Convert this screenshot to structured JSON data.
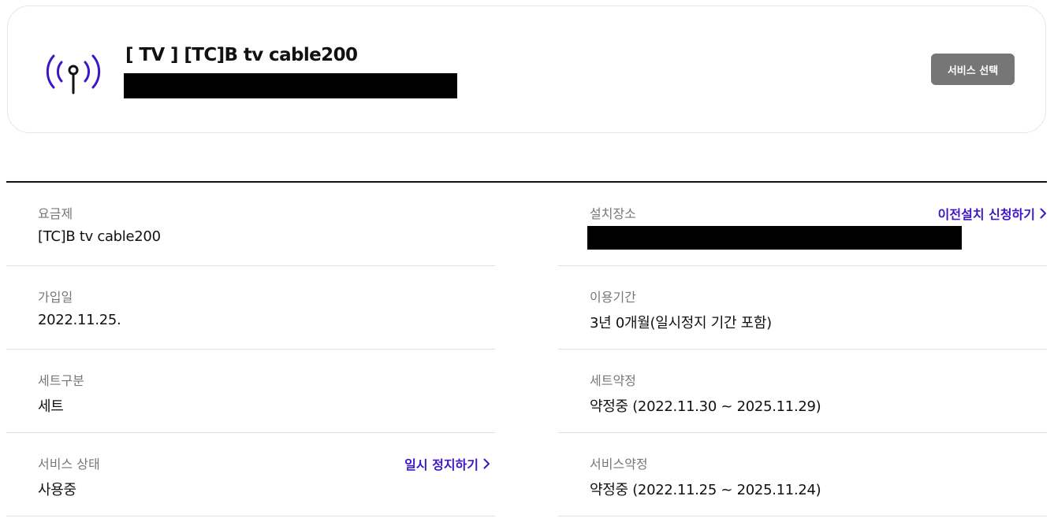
{
  "service_card": {
    "icon": "broadcast-antenna-icon",
    "title": "[ TV ] [TC]B tv cable200",
    "select_button": "서비스 선택"
  },
  "details": {
    "left": [
      {
        "label": "요금제",
        "value": "[TC]B tv cable200"
      },
      {
        "label": "가입일",
        "value": "2022.11.25."
      },
      {
        "label": "세트구분",
        "value": "세트"
      },
      {
        "label": "서비스 상태",
        "value": "사용중",
        "link": "일시 정지하기"
      }
    ],
    "right": [
      {
        "label": "설치장소",
        "link": "이전설치 신청하기"
      },
      {
        "label": "이용기간",
        "value": "3년 0개월(일시정지 기간 포함)"
      },
      {
        "label": "세트약정",
        "value": "약정중 (2022.11.30 ~ 2025.11.29)"
      },
      {
        "label": "서비스약정",
        "value": "약정중 (2022.11.25 ~ 2025.11.24)"
      }
    ]
  },
  "colors": {
    "link": "#3d16c8",
    "icon_arc": "#3d16c8",
    "button_bg": "#767676"
  }
}
